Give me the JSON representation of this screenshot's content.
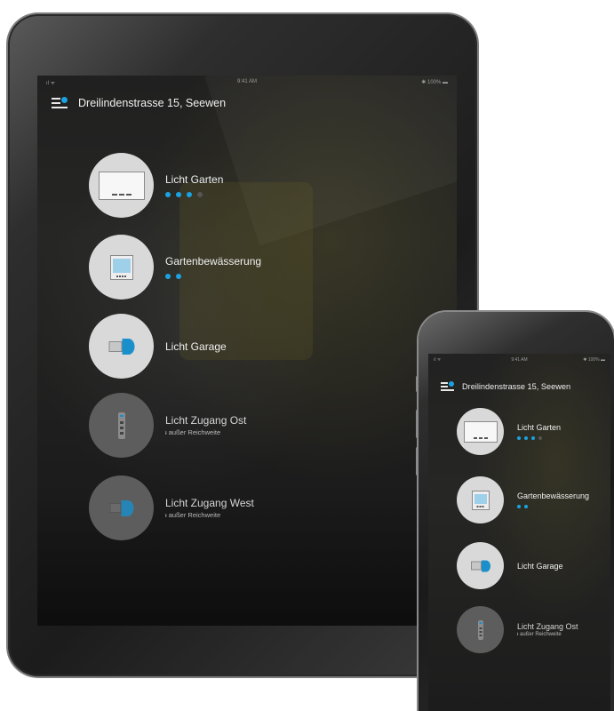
{
  "tablet": {
    "status_bar": {
      "signal": "ıl ᯤ",
      "time": "9:41 AM",
      "battery": "✱ 100% ▬"
    },
    "header": {
      "title": "Dreilindenstrasse 15, Seewen",
      "menu_icon": "menu-with-dot-icon",
      "accent_color": "#1aa3e0"
    },
    "devices": [
      {
        "name": "Licht Garten",
        "icon": "wall-panel-icon",
        "signal_dots": 3,
        "signal_max": 4,
        "status": "",
        "reachable": true
      },
      {
        "name": "Gartenbewässerung",
        "icon": "controller-icon",
        "signal_dots": 2,
        "signal_max": 2,
        "status": "",
        "reachable": true
      },
      {
        "name": "Licht Garage",
        "icon": "usb-stick-icon",
        "signal_dots": 0,
        "signal_max": 0,
        "status": "",
        "reachable": true
      },
      {
        "name": "Licht Zugang Ost",
        "icon": "remote-icon",
        "signal_dots": 0,
        "signal_max": 0,
        "status": "ᵻ außer Reichweite",
        "reachable": false
      },
      {
        "name": "Licht Zugang West",
        "icon": "usb-stick-icon",
        "signal_dots": 0,
        "signal_max": 0,
        "status": "ᵻ außer Reichweite",
        "reachable": false
      }
    ]
  },
  "phone": {
    "status_bar": {
      "signal": "ıl ᯤ",
      "time": "9:41 AM",
      "battery": "✱ 100% ▬"
    },
    "header": {
      "title": "Dreilindenstrasse 15, Seewen"
    },
    "devices": [
      {
        "name": "Licht Garten",
        "signal_dots": 3,
        "signal_max": 4,
        "status": ""
      },
      {
        "name": "Gartenbewässerung",
        "signal_dots": 2,
        "signal_max": 2,
        "status": ""
      },
      {
        "name": "Licht Garage",
        "signal_dots": 0,
        "signal_max": 0,
        "status": ""
      },
      {
        "name": "Licht Zugang Ost",
        "signal_dots": 0,
        "signal_max": 0,
        "status": "ᵻ außer Reichweite"
      }
    ]
  },
  "colors": {
    "accent": "#1aa3e0",
    "device_circle": "#d9d9d9",
    "device_circle_inactive": "#5d5d5d"
  }
}
